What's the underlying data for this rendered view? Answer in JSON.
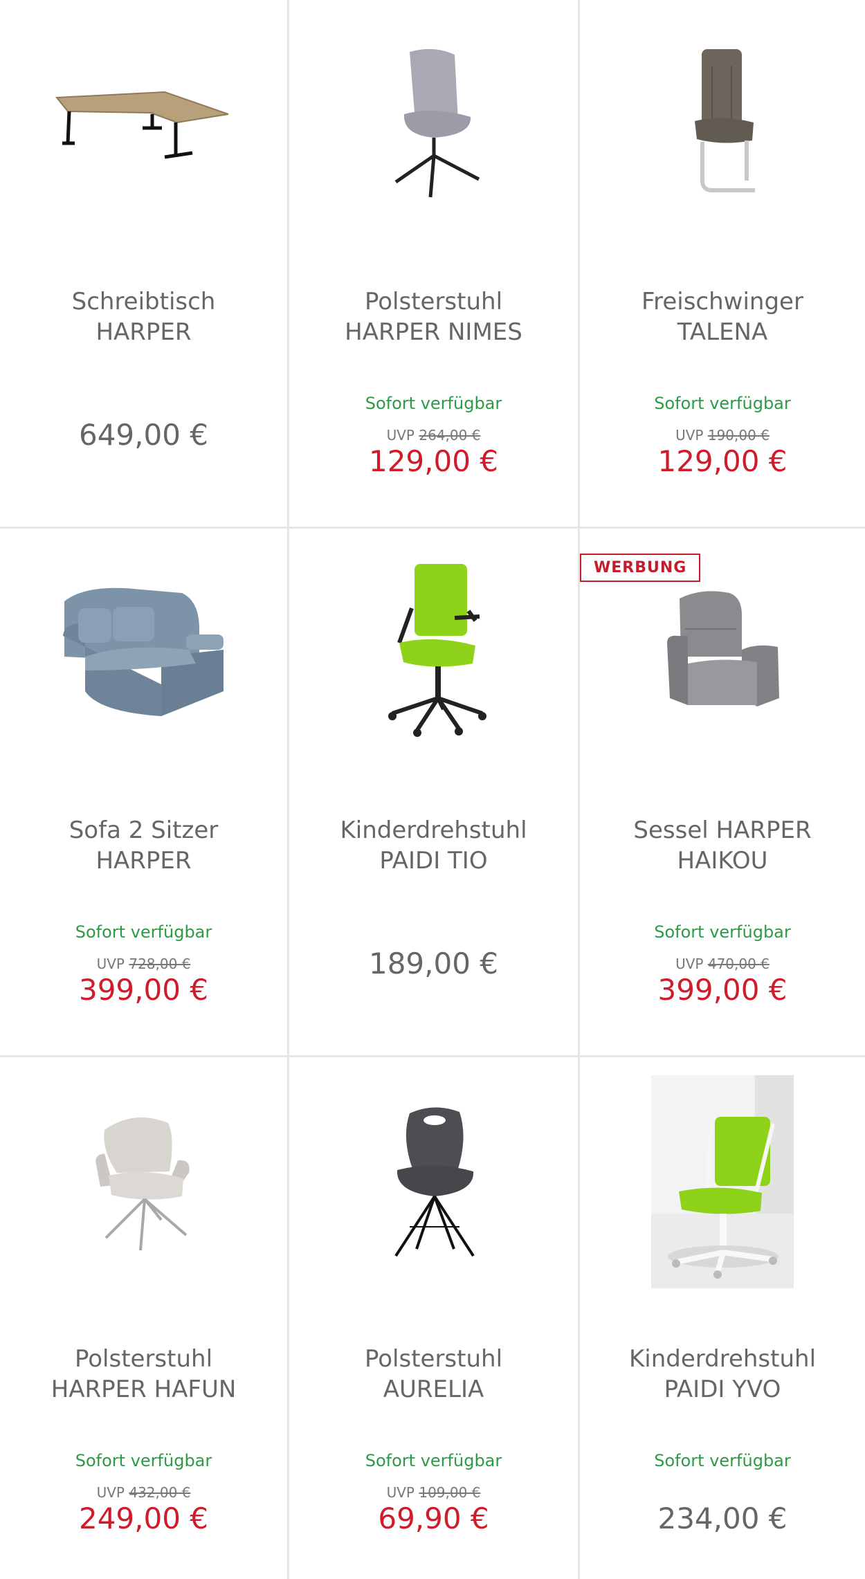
{
  "products": [
    {
      "line1": "Schreibtisch",
      "line2": "HARPER",
      "availability": "",
      "uvp_label": "",
      "uvp_price": "",
      "price": "649,00 €",
      "image_icon": "desk-icon"
    },
    {
      "line1": "Polsterstuhl",
      "line2": "HARPER NIMES",
      "availability": "Sofort verfügbar",
      "uvp_label": "UVP",
      "uvp_price": "264,00 €",
      "price": "129,00 €",
      "image_icon": "chair-icon"
    },
    {
      "line1": "Freischwinger",
      "line2": "TALENA",
      "availability": "Sofort verfügbar",
      "uvp_label": "UVP",
      "uvp_price": "190,00 €",
      "price": "129,00 €",
      "image_icon": "cantilever-chair-icon"
    },
    {
      "line1": "Sofa 2 Sitzer",
      "line2": "HARPER",
      "availability": "Sofort verfügbar",
      "uvp_label": "UVP",
      "uvp_price": "728,00 €",
      "price": "399,00 €",
      "image_icon": "sofa-icon"
    },
    {
      "line1": "Kinderdrehstuhl",
      "line2": "PAIDI TIO",
      "availability": "",
      "uvp_label": "",
      "uvp_price": "",
      "price": "189,00 €",
      "image_icon": "office-chair-icon"
    },
    {
      "line1": "Sessel HARPER",
      "line2": "HAIKOU",
      "availability": "Sofort verfügbar",
      "uvp_label": "UVP",
      "uvp_price": "470,00 €",
      "price": "399,00 €",
      "image_icon": "armchair-icon",
      "badge": "WERBUNG"
    },
    {
      "line1": "Polsterstuhl",
      "line2": "HARPER HAFUN",
      "availability": "Sofort verfügbar",
      "uvp_label": "UVP",
      "uvp_price": "432,00 €",
      "price": "249,00 €",
      "image_icon": "chair-icon"
    },
    {
      "line1": "Polsterstuhl",
      "line2": "AURELIA",
      "availability": "Sofort verfügbar",
      "uvp_label": "UVP",
      "uvp_price": "109,00 €",
      "price": "69,90 €",
      "image_icon": "chair-icon"
    },
    {
      "line1": "Kinderdrehstuhl",
      "line2": "PAIDI YVO",
      "availability": "Sofort verfügbar",
      "uvp_label": "",
      "uvp_price": "",
      "price": "234,00 €",
      "image_icon": "office-chair-icon"
    }
  ],
  "colors": {
    "availability_green": "#2e9a45",
    "sale_red": "#d01b2a",
    "text_gray": "#666666",
    "divider": "#e6e6e6",
    "chair_green": "#8fd21a"
  }
}
